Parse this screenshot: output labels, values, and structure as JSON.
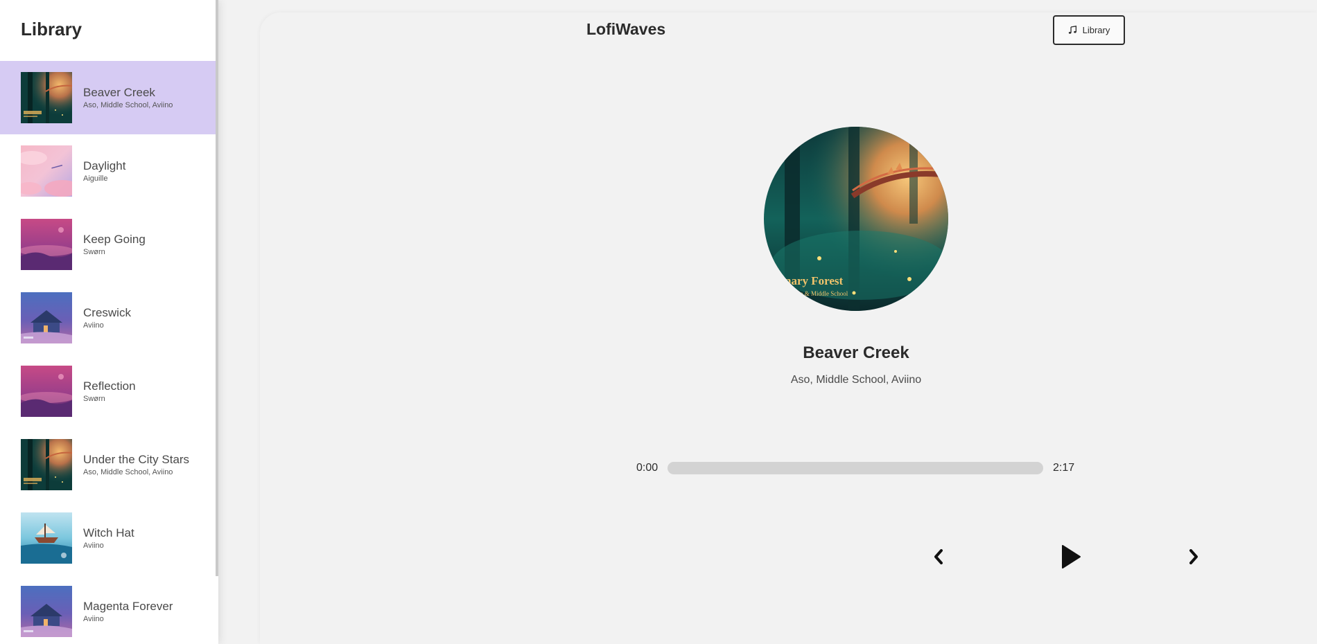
{
  "sidebar": {
    "title": "Library",
    "songs": [
      {
        "title": "Beaver Creek",
        "artist": "Aso, Middle School, Aviino",
        "active": true,
        "art": "forest"
      },
      {
        "title": "Daylight",
        "artist": "Aiguille",
        "active": false,
        "art": "pink-sky"
      },
      {
        "title": "Keep Going",
        "artist": "Swørn",
        "active": false,
        "art": "magenta"
      },
      {
        "title": "Creswick",
        "artist": "Aviino",
        "active": false,
        "art": "cabin"
      },
      {
        "title": "Reflection",
        "artist": "Swørn",
        "active": false,
        "art": "magenta"
      },
      {
        "title": "Under the City Stars",
        "artist": "Aso, Middle School, Aviino",
        "active": false,
        "art": "forest"
      },
      {
        "title": "Witch Hat",
        "artist": "Aviino",
        "active": false,
        "art": "ship"
      },
      {
        "title": "Magenta Forever",
        "artist": "Aviino",
        "active": false,
        "art": "cabin"
      }
    ]
  },
  "header": {
    "app_title": "LofiWaves",
    "library_button_label": "Library",
    "library_button_icon": "music-note-icon"
  },
  "player": {
    "title": "Beaver Creek",
    "artist": "Aso, Middle School, Aviino",
    "cover_caption_line1": "nary Forest",
    "cover_caption_line2": "Aiino & Middle School",
    "current_time": "0:00",
    "total_time": "2:17",
    "progress_fraction": 0,
    "controls": {
      "prev_icon": "chevron-left-icon",
      "play_icon": "play-icon",
      "next_icon": "chevron-right-icon"
    }
  },
  "colors": {
    "active_item": "#d6cbf3",
    "background": "#f2f2f2",
    "progress_track": "#d3d3d3",
    "text": "#2b2b2b"
  }
}
